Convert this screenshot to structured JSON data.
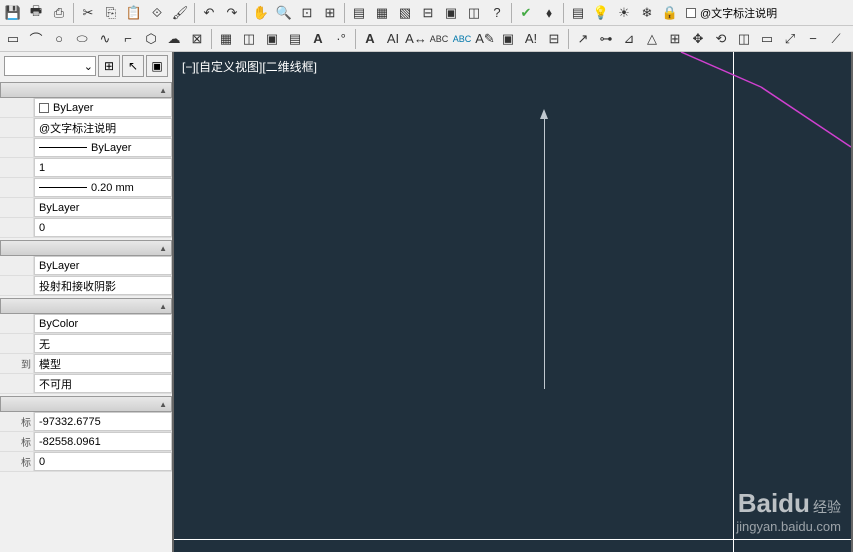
{
  "layer_display": "@文字标注说明",
  "viewport_label": "[−][自定义视图][二维线框]",
  "properties": {
    "section1": {
      "color": "ByLayer",
      "layer": "@文字标注说明",
      "linetype": "ByLayer",
      "linescale": "1",
      "lineweight": "0.20 mm",
      "material": "ByLayer",
      "transparency": "0"
    },
    "section2": {
      "plotstyle": "ByLayer",
      "shadow": "投射和接收阴影"
    },
    "section3": {
      "plotstyle_color": "ByColor",
      "hyperlink": "无",
      "layout": "模型",
      "annotative": "不可用"
    },
    "section4": {
      "label_to": "到",
      "label_coord": "标",
      "x": "-97332.6775",
      "y": "-82558.0961",
      "z": "0"
    }
  },
  "watermark": {
    "brand": "Baidu",
    "sub": "经验",
    "url": "jingyan.baidu.com"
  }
}
